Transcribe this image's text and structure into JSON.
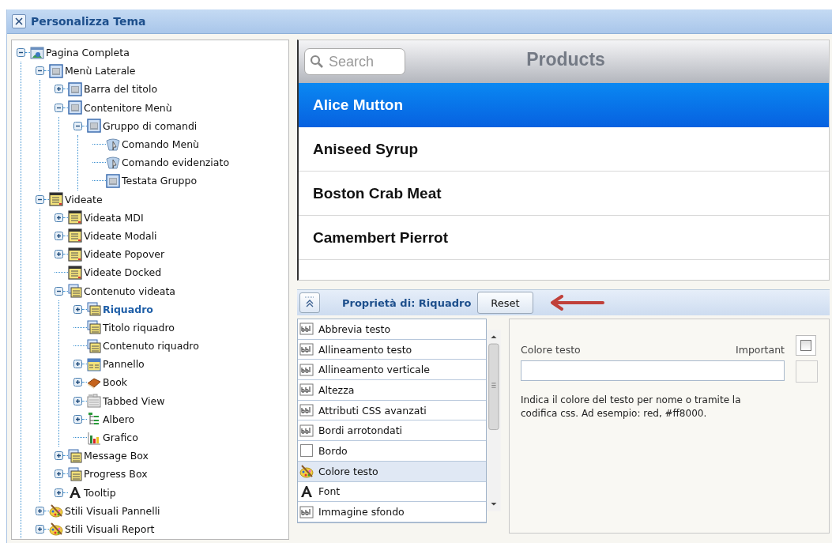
{
  "window": {
    "title": "Personalizza Tema"
  },
  "tree": [
    {
      "label": "Pagina Completa",
      "kind": "page",
      "expanded": true,
      "selected": false,
      "children": [
        {
          "label": "Menù Laterale",
          "kind": "menu",
          "expanded": true,
          "selected": false,
          "children": [
            {
              "label": "Barra del titolo",
              "kind": "menu",
              "expanded": false,
              "selected": false
            },
            {
              "label": "Contenitore Menù",
              "kind": "menu",
              "expanded": true,
              "selected": false,
              "children": [
                {
                  "label": "Gruppo di comandi",
                  "kind": "menu",
                  "expanded": true,
                  "selected": false,
                  "children": [
                    {
                      "label": "Comando Menù",
                      "kind": "command",
                      "selected": false
                    },
                    {
                      "label": "Comando evidenziato",
                      "kind": "command",
                      "selected": false
                    },
                    {
                      "label": "Testata Gruppo",
                      "kind": "menu",
                      "selected": false
                    }
                  ]
                }
              ]
            }
          ]
        },
        {
          "label": "Videate",
          "kind": "screen",
          "expanded": true,
          "selected": false,
          "children": [
            {
              "label": "Videata MDI",
              "kind": "screen",
              "expanded": false,
              "selected": false
            },
            {
              "label": "Videate Modali",
              "kind": "screen",
              "expanded": false,
              "selected": false
            },
            {
              "label": "Videate Popover",
              "kind": "screen",
              "expanded": false,
              "selected": false
            },
            {
              "label": "Videate Docked",
              "kind": "screen",
              "selected": false
            },
            {
              "label": "Contenuto videata",
              "kind": "stack",
              "expanded": true,
              "selected": false,
              "children": [
                {
                  "label": "Riquadro",
                  "kind": "stack",
                  "expanded": false,
                  "selected": true
                },
                {
                  "label": "Titolo riquadro",
                  "kind": "stack",
                  "selected": false
                },
                {
                  "label": "Contenuto riquadro",
                  "kind": "stack",
                  "selected": false
                },
                {
                  "label": "Pannello",
                  "kind": "panel",
                  "expanded": false,
                  "selected": false
                },
                {
                  "label": "Book",
                  "kind": "book",
                  "expanded": false,
                  "selected": false
                },
                {
                  "label": "Tabbed View",
                  "kind": "tabs",
                  "expanded": false,
                  "selected": false
                },
                {
                  "label": "Albero",
                  "kind": "tree",
                  "expanded": false,
                  "selected": false
                },
                {
                  "label": "Grafico",
                  "kind": "chart",
                  "selected": false
                }
              ]
            },
            {
              "label": "Message Box",
              "kind": "stack",
              "expanded": false,
              "selected": false
            },
            {
              "label": "Progress Box",
              "kind": "stack",
              "expanded": false,
              "selected": false
            },
            {
              "label": "Tooltip",
              "kind": "font",
              "expanded": false,
              "selected": false
            }
          ]
        },
        {
          "label": "Stili Visuali Pannelli",
          "kind": "palette",
          "expanded": false,
          "selected": false
        },
        {
          "label": "Stili Visuali Report",
          "kind": "palette",
          "expanded": false,
          "selected": false
        }
      ]
    }
  ],
  "preview": {
    "search": {
      "placeholder": "Search"
    },
    "title": "Products",
    "rows": [
      {
        "label": "Alice Mutton",
        "selected": true
      },
      {
        "label": "Aniseed Syrup",
        "selected": false
      },
      {
        "label": "Boston Crab Meat",
        "selected": false
      },
      {
        "label": "Camembert Pierrot",
        "selected": false
      }
    ]
  },
  "properties": {
    "title": "Proprietà di: Riquadro",
    "reset": "Reset",
    "items": [
      {
        "label": "Abbrevia testo",
        "kind": "text",
        "selected": false
      },
      {
        "label": "Allineamento testo",
        "kind": "text",
        "selected": false
      },
      {
        "label": "Allineamento verticale",
        "kind": "text",
        "selected": false
      },
      {
        "label": "Altezza",
        "kind": "text",
        "selected": false
      },
      {
        "label": "Attributi CSS avanzati",
        "kind": "text",
        "selected": false
      },
      {
        "label": "Bordi arrotondati",
        "kind": "text",
        "selected": false
      },
      {
        "label": "Bordo",
        "kind": "box",
        "selected": false
      },
      {
        "label": "Colore testo",
        "kind": "palette",
        "selected": true
      },
      {
        "label": "Font",
        "kind": "font",
        "selected": false
      },
      {
        "label": "Immagine sfondo",
        "kind": "text",
        "selected": false
      }
    ]
  },
  "detail": {
    "label": "Colore testo",
    "important": {
      "label": "Important",
      "checked": false
    },
    "help": "Indica il colore del testo per nome o tramite la codifica css. Ad esempio: red, #ff8000."
  }
}
